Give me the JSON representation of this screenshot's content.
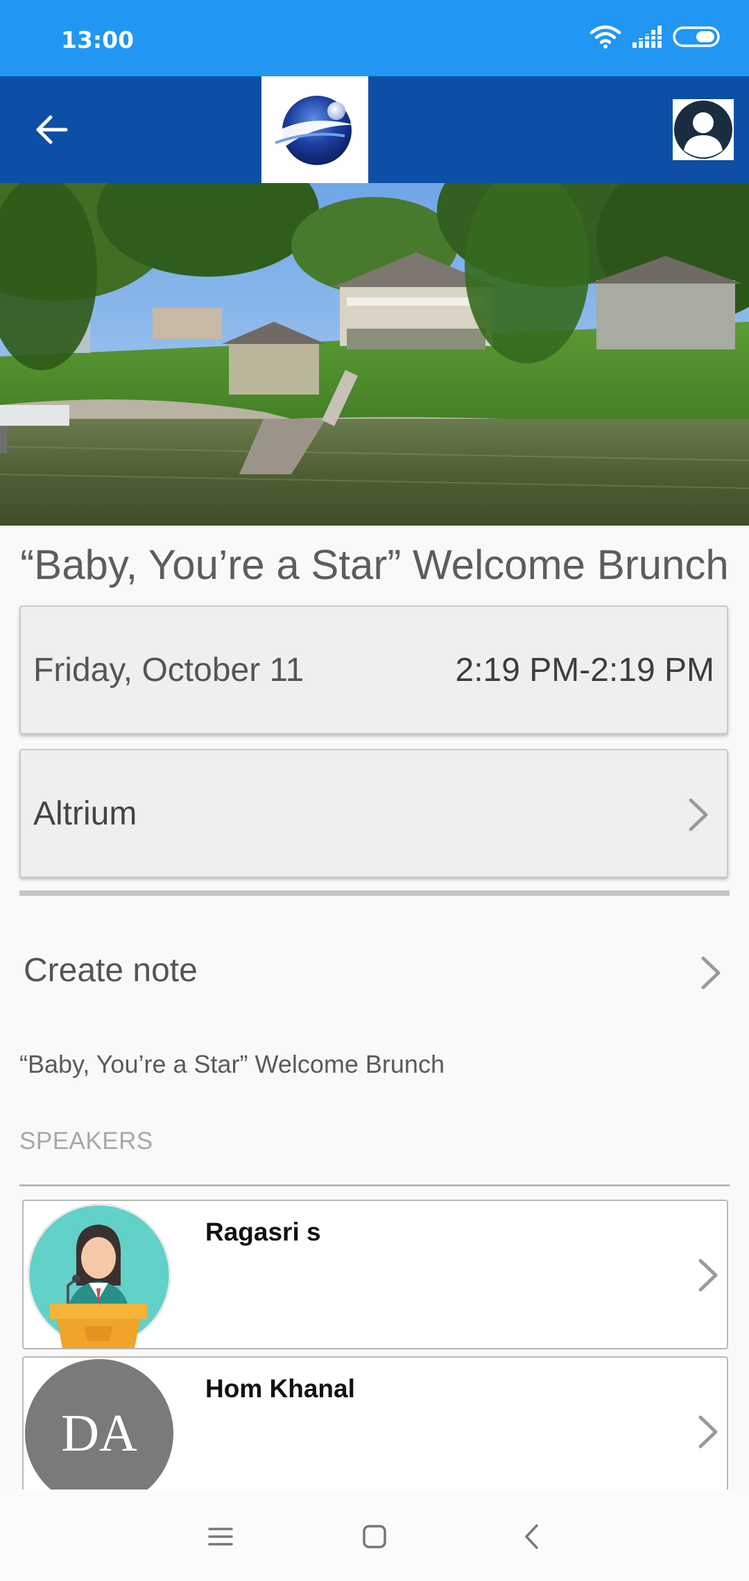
{
  "status_bar": {
    "time": "13:00"
  },
  "app_bar": {
    "back_icon": "arrow-left-icon",
    "profile_icon": "user-avatar-icon"
  },
  "event": {
    "title": "“Baby, You’re a Star” Welcome Brunch",
    "date": "Friday, October 11",
    "time_range": "2:19 PM-2:19 PM",
    "location": "Altrium",
    "description": "“Baby, You’re a Star” Welcome Brunch"
  },
  "note": {
    "label": "Create note"
  },
  "speakers": {
    "header": "SPEAKERS",
    "items": [
      {
        "name": "Ragasri s",
        "avatar": "speaker-podium-icon"
      },
      {
        "name": "Hom Khanal",
        "initials": "DA"
      }
    ]
  },
  "nav": {
    "menu_icon": "menu-icon",
    "home_icon": "home-square-icon",
    "back_icon": "back-chevron-icon"
  },
  "colors": {
    "status_bar": "#2196f3",
    "app_bar": "#0d4fa6",
    "card_bg": "#efefef",
    "text": "#555555"
  }
}
